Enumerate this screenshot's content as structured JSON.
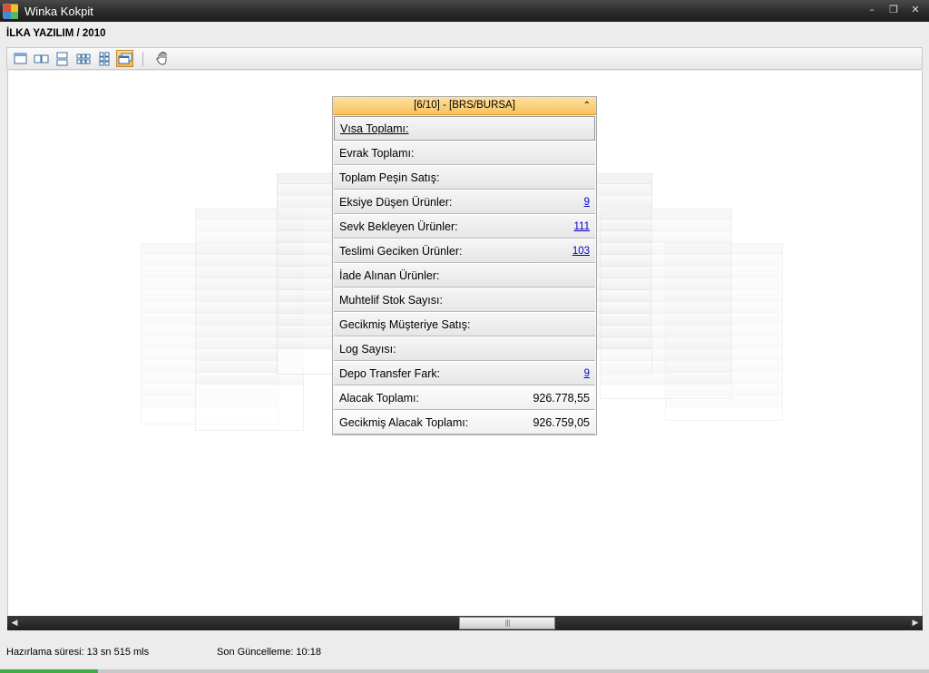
{
  "window": {
    "title": "Winka Kokpit",
    "minimize": "–",
    "restore": "❐",
    "close": "✕"
  },
  "company": "İLKA YAZILIM / 2010",
  "toolbar": {
    "buttons": [
      "single-view-icon",
      "two-column-view-icon",
      "two-row-view-icon",
      "multi-tile-view-icon",
      "grid-view-icon",
      "carousel-view-icon",
      "pan-hand-icon"
    ],
    "active": "carousel-view-icon"
  },
  "panel": {
    "header": "[6/10] - [BRS/BURSA]",
    "collapse": "⌃",
    "rows": [
      {
        "label": "Vısa Toplamı:",
        "value": ""
      },
      {
        "label": "Evrak Toplamı:",
        "value": ""
      },
      {
        "label": "Toplam Peşin Satış:",
        "value": ""
      },
      {
        "label": "Eksiye Düşen Ürünler:",
        "value": "9"
      },
      {
        "label": "Sevk Bekleyen Ürünler:",
        "value": "111"
      },
      {
        "label": "Teslimi Geciken Ürünler:",
        "value": "103"
      },
      {
        "label": "İade Alınan Ürünler:",
        "value": ""
      },
      {
        "label": "Muhtelif Stok Sayısı:",
        "value": ""
      },
      {
        "label": "Gecikmiş Müşteriye Satış:",
        "value": ""
      },
      {
        "label": "Log Sayısı:",
        "value": ""
      },
      {
        "label": "Depo Transfer Fark:",
        "value": "9"
      },
      {
        "label": "Alacak Toplamı:",
        "value": "926.778,55"
      },
      {
        "label": "Gecikmiş Alacak Toplamı:",
        "value": "926.759,05"
      }
    ]
  },
  "scrollbar": {
    "left": "◀",
    "right": "▶",
    "grip": "|||"
  },
  "status": {
    "prep_time": "Hazırlama süresi: 13 sn 515 mls",
    "last_update": "Son Güncelleme: 10:18"
  }
}
